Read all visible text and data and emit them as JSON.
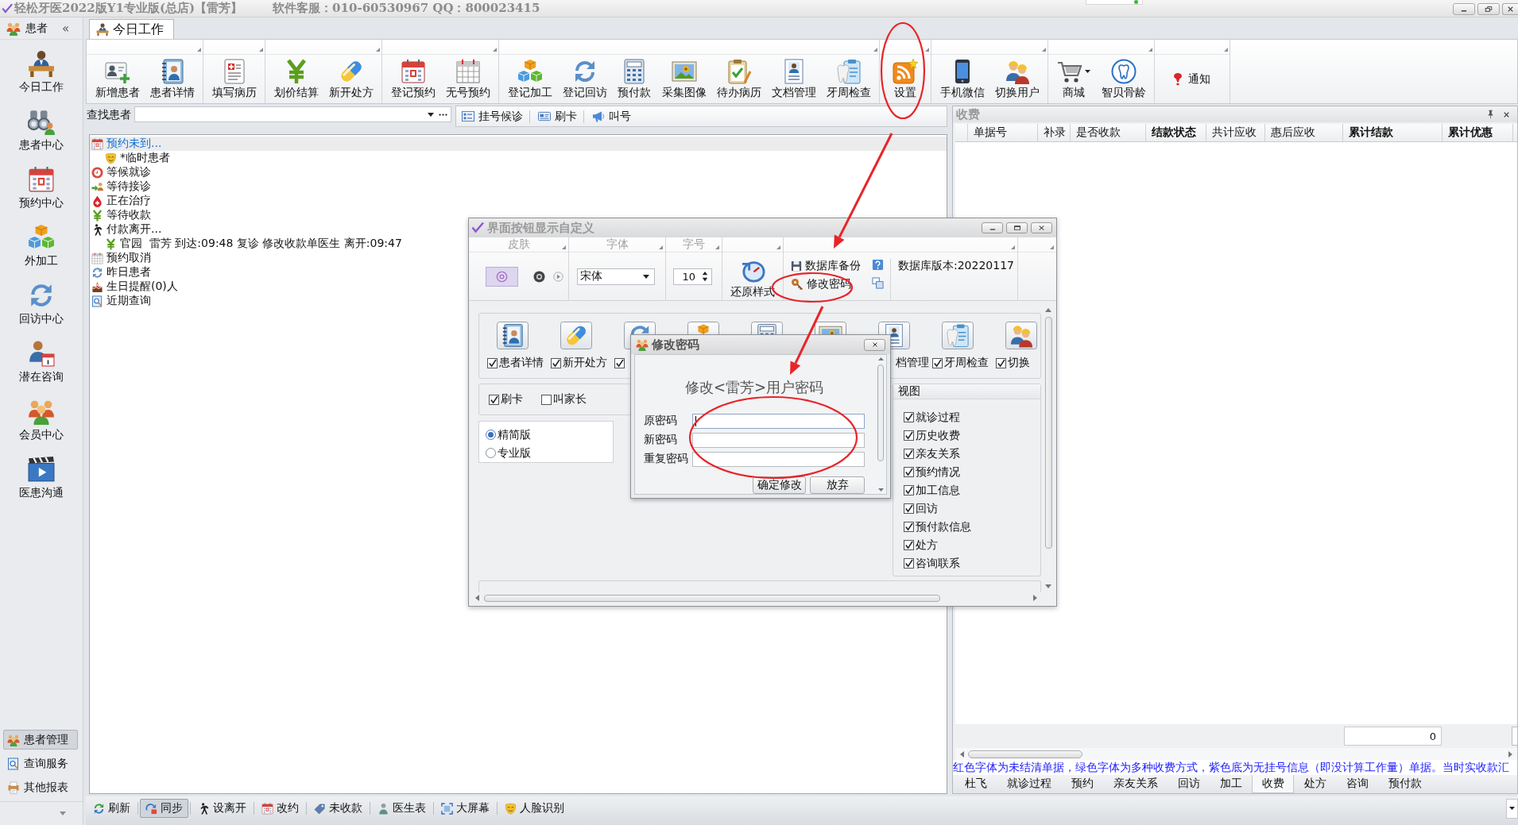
{
  "window": {
    "title": "轻松牙医2022版Y1专业版(总店)【雷芳】",
    "support": "软件客服：010-60530967 QQ：800023415"
  },
  "nav": {
    "header": "患者",
    "collapse": "«",
    "items": [
      {
        "label": "今日工作"
      },
      {
        "label": "患者中心"
      },
      {
        "label": "预约中心"
      },
      {
        "label": "外加工"
      },
      {
        "label": "回访中心"
      },
      {
        "label": "潜在咨询"
      },
      {
        "label": "会员中心"
      },
      {
        "label": "医患沟通"
      }
    ],
    "sections": [
      {
        "label": "患者管理",
        "selected": true
      },
      {
        "label": "查询服务",
        "selected": false
      },
      {
        "label": "其他报表",
        "selected": false
      }
    ]
  },
  "tabs": [
    {
      "label": "今日工作",
      "selected": true
    }
  ],
  "toolbar": {
    "groups": [
      {
        "kind": "large",
        "items": [
          {
            "label": "新增患者"
          },
          {
            "label": "患者详情"
          }
        ]
      },
      {
        "kind": "large",
        "items": [
          {
            "label": "填写病历"
          }
        ]
      },
      {
        "kind": "large",
        "items": [
          {
            "label": "划价结算"
          },
          {
            "label": "新开处方"
          }
        ]
      },
      {
        "kind": "large",
        "items": [
          {
            "label": "登记预约"
          },
          {
            "label": "无号预约"
          }
        ]
      },
      {
        "kind": "large",
        "items": [
          {
            "label": "登记加工"
          },
          {
            "label": "登记回访"
          },
          {
            "label": "预付款"
          },
          {
            "label": "采集图像"
          },
          {
            "label": "待办病历"
          },
          {
            "label": "文档管理"
          },
          {
            "label": "牙周检查"
          }
        ]
      },
      {
        "kind": "large",
        "items": [
          {
            "label": "设置"
          }
        ]
      },
      {
        "kind": "large",
        "items": [
          {
            "label": "手机微信"
          },
          {
            "label": "切换用户"
          }
        ]
      },
      {
        "kind": "large",
        "items": [
          {
            "label": "商城",
            "dropdown": true
          },
          {
            "label": "智贝骨龄",
            "dropdown": false
          }
        ]
      },
      {
        "kind": "compact",
        "items": [
          {
            "label": "通知"
          }
        ]
      }
    ]
  },
  "search": {
    "label": "查找患者"
  },
  "queue_buttons": [
    {
      "label": "挂号候诊"
    },
    {
      "label": "刷卡"
    },
    {
      "label": "叫号"
    }
  ],
  "tree": [
    {
      "label": "预约未到...",
      "selected": true,
      "children": [
        {
          "label": "*临时患者",
          "selected": false
        }
      ]
    },
    {
      "label": "等候就诊",
      "selected": false
    },
    {
      "label": "等待接诊",
      "selected": false
    },
    {
      "label": "正在治疗",
      "selected": false
    },
    {
      "label": "等待收款",
      "selected": false
    },
    {
      "label": "付款离开...",
      "selected": false,
      "children": [
        {
          "label": "官园  雷芳 到达:09:48 复诊 修改收款单医生 离开:09:47",
          "selected": false
        }
      ]
    },
    {
      "label": "预约取消",
      "selected": false
    },
    {
      "label": "昨日患者",
      "selected": false
    },
    {
      "label": "生日提醒(0)人",
      "selected": false
    },
    {
      "label": "近期查询",
      "selected": false
    }
  ],
  "fee_panel": {
    "title": "收费",
    "columns": [
      {
        "label": "单据号",
        "bold": false
      },
      {
        "label": "补录",
        "bold": false
      },
      {
        "label": "是否收款",
        "bold": false
      },
      {
        "label": "结款状态",
        "bold": true
      },
      {
        "label": "共计应收",
        "bold": false
      },
      {
        "label": "惠后应收",
        "bold": false
      },
      {
        "label": "累计结款",
        "bold": true
      },
      {
        "label": "累计优惠",
        "bold": true
      }
    ],
    "total": "0",
    "legend": "红色字体为未结清单据，绿色字体为多种收费方式，紫色底为无挂号信息（即没计算工作量）单据。当时实收款汇",
    "tabs": [
      {
        "label": "杜飞",
        "selected": false
      },
      {
        "label": "就诊过程",
        "selected": false
      },
      {
        "label": "预约",
        "selected": false
      },
      {
        "label": "亲友关系",
        "selected": false
      },
      {
        "label": "回访",
        "selected": false
      },
      {
        "label": "加工",
        "selected": false
      },
      {
        "label": "收费",
        "selected": true
      },
      {
        "label": "处方",
        "selected": false
      },
      {
        "label": "咨询",
        "selected": false
      },
      {
        "label": "预付款",
        "selected": false
      }
    ]
  },
  "bottom_bar": [
    {
      "label": "刷新",
      "selected": false
    },
    {
      "label": "同步",
      "selected": true
    },
    {
      "label": "设离开",
      "selected": false
    },
    {
      "label": "改约",
      "selected": false
    },
    {
      "label": "未收款",
      "selected": false
    },
    {
      "label": "医生表",
      "selected": false
    },
    {
      "label": "大屏幕",
      "selected": false
    },
    {
      "label": "人脸识别",
      "selected": false
    }
  ],
  "dialog": {
    "title": "界面按钮显示自定义",
    "ribbon": {
      "skin": {
        "title": "皮肤",
        "skins": [
          {
            "selected": true
          },
          {
            "selected": false
          }
        ]
      },
      "font": {
        "title": "字体",
        "value": "宋体"
      },
      "size": {
        "title": "字号",
        "value": "10"
      },
      "restore": {
        "label": "还原样式"
      },
      "database": {
        "backup": "数据库备份",
        "change_password": "修改密码",
        "version": "数据库版本:20220117"
      }
    },
    "buttons": [
      {
        "kind": "full",
        "label": "患者详情",
        "checked": true
      },
      {
        "kind": "full",
        "label": "新开处方",
        "checked": true
      },
      {
        "kind": "check",
        "checked": true
      },
      {
        "kind": "icon"
      },
      {
        "kind": "icon"
      },
      {
        "kind": "icon"
      },
      {
        "kind": "text",
        "label": "档管理"
      },
      {
        "kind": "full",
        "label": "牙周检查",
        "checked": true
      },
      {
        "kind": "full",
        "label": "切换",
        "checked": true
      }
    ],
    "options": [
      {
        "label": "刷卡",
        "checked": true
      },
      {
        "label": "叫家长",
        "checked": false
      }
    ],
    "editions": [
      {
        "label": "精简版",
        "selected": true
      },
      {
        "label": "专业版",
        "selected": false
      }
    ],
    "view": {
      "title": "视图",
      "items": [
        {
          "label": "就诊过程",
          "checked": true
        },
        {
          "label": "历史收费",
          "checked": true
        },
        {
          "label": "亲友关系",
          "checked": true
        },
        {
          "label": "预约情况",
          "checked": true
        },
        {
          "label": "加工信息",
          "checked": true
        },
        {
          "label": "回访",
          "checked": true
        },
        {
          "label": "预付款信息",
          "checked": true
        },
        {
          "label": "处方",
          "checked": true
        },
        {
          "label": "咨询联系",
          "checked": true
        }
      ]
    },
    "popup": {
      "title": "修改密码",
      "heading": "修改<雷芳>用户密码",
      "fields": [
        {
          "label": "原密码",
          "focused": true
        },
        {
          "label": "新密码",
          "focused": false
        },
        {
          "label": "重复密码",
          "focused": false
        }
      ],
      "buttons": [
        {
          "label": "确定修改"
        },
        {
          "label": "放弃"
        }
      ]
    }
  }
}
